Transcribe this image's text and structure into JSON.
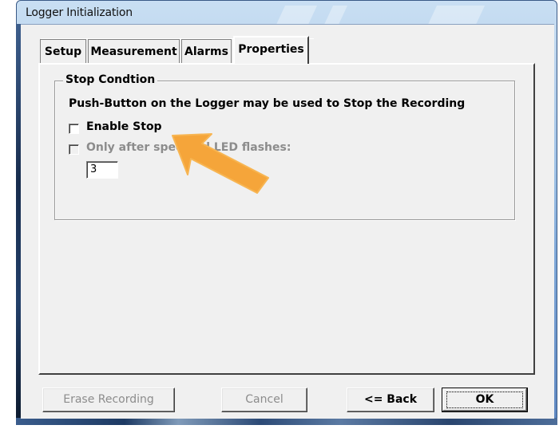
{
  "window": {
    "title": "Logger Initialization"
  },
  "tabs": [
    {
      "label": "Setup",
      "selected": false
    },
    {
      "label": "Measurement",
      "selected": false
    },
    {
      "label": "Alarms",
      "selected": false
    },
    {
      "label": "Properties",
      "selected": true
    }
  ],
  "stop_condition": {
    "group_label": "Stop Condtion",
    "description": "Push-Button on the Logger may be used to Stop the Recording",
    "enable_stop": {
      "label": "Enable Stop",
      "checked": false
    },
    "only_after": {
      "label": "Only after specified LED flashes:",
      "checked": false,
      "enabled": false
    },
    "flash_count": "3"
  },
  "buttons": {
    "erase": "Erase Recording",
    "cancel": "Cancel",
    "back": "<= Back",
    "ok": "OK"
  },
  "annotation": {
    "icon": "arrow-pointer-icon",
    "color": "#f5a53a"
  },
  "colors": {
    "dialog_bg": "#f0f0f0",
    "disabled_text": "#8c8c8c",
    "frame_blue": "#7fa8d8"
  }
}
